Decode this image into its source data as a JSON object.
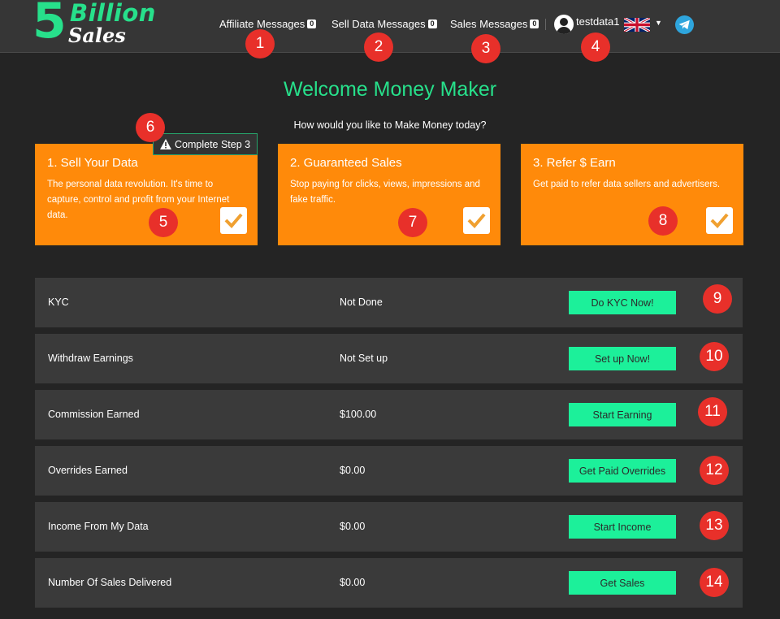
{
  "logo": {
    "five": "5",
    "billion": "Billion",
    "sales": "Sales"
  },
  "nav": {
    "items": [
      {
        "label": "Affiliate Messages",
        "count": "0"
      },
      {
        "label": "Sell Data Messages",
        "count": "0"
      },
      {
        "label": "Sales Messages",
        "count": "0"
      }
    ],
    "username": "testdata1",
    "language": "gb-flag-icon",
    "telegram": "telegram-icon"
  },
  "welcome": {
    "title": "Welcome Money Maker",
    "subtitle": "How would you like to Make Money today?"
  },
  "step_badge": "Complete Step 3",
  "cards": [
    {
      "title": "1. Sell Your Data",
      "desc": "The personal data revolution. It's time to capture, control and profit from your Internet data."
    },
    {
      "title": "2. Guaranteed Sales",
      "desc": "Stop paying for clicks, views, impressions and fake traffic."
    },
    {
      "title": "3. Refer $ Earn",
      "desc": "Get paid to refer data sellers and advertisers."
    }
  ],
  "rows": [
    {
      "label": "KYC",
      "value": "Not Done",
      "button": "Do KYC Now!"
    },
    {
      "label": "Withdraw Earnings",
      "value": "Not Set up",
      "button": "Set up Now!"
    },
    {
      "label": "Commission Earned",
      "value": "$100.00",
      "button": "Start Earning"
    },
    {
      "label": "Overrides Earned",
      "value": "$0.00",
      "button": "Get Paid Overrides"
    },
    {
      "label": "Income From My Data",
      "value": "$0.00",
      "button": "Start Income"
    },
    {
      "label": "Number Of Sales Delivered",
      "value": "$0.00",
      "button": "Get Sales"
    }
  ],
  "markers": [
    "1",
    "2",
    "3",
    "4",
    "5",
    "6",
    "7",
    "8",
    "9",
    "10",
    "11",
    "12",
    "13",
    "14"
  ],
  "colors": {
    "accent": "#27e08b",
    "button": "#1cf09a",
    "card": "#ff8a0a",
    "marker": "#e8302a",
    "background": "#242424"
  }
}
